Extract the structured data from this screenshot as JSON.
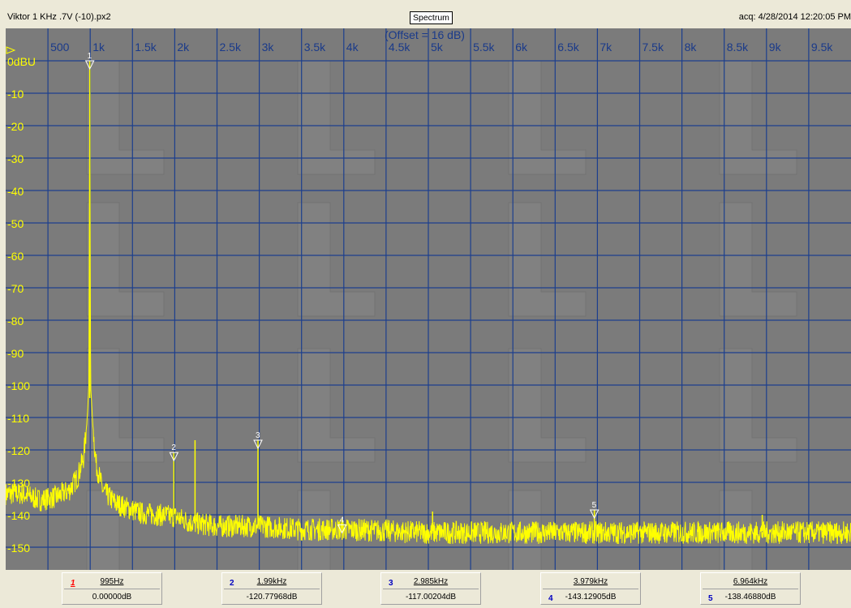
{
  "window": {
    "file_title": "Viktor 1 KHz .7V (-10).px2",
    "view_button": "Spectrum",
    "acq_label": "acq: 4/28/2014 12:20:05 PM"
  },
  "colors": {
    "plot_bg": "#7b7b7b",
    "grid": "#1c3f8e",
    "trace": "#ffff00",
    "y_tick_text": "#ffff00",
    "x_tick_text": "#1a3a8a",
    "marker": "#ffffff",
    "marker_1_number": "#ff0000",
    "marker_number": "#0000c0"
  },
  "chart_data": {
    "type": "line",
    "annotation": "(Offset = 16 dB)",
    "x_unit": "Hz",
    "y_unit": "dBU",
    "xlim": [
      0,
      10000
    ],
    "ylim": [
      -157,
      10
    ],
    "x_ticks": [
      {
        "value": 500,
        "label": "500"
      },
      {
        "value": 1000,
        "label": "1k"
      },
      {
        "value": 1500,
        "label": "1.5k"
      },
      {
        "value": 2000,
        "label": "2k"
      },
      {
        "value": 2500,
        "label": "2.5k"
      },
      {
        "value": 3000,
        "label": "3k"
      },
      {
        "value": 3500,
        "label": "3.5k"
      },
      {
        "value": 4000,
        "label": "4k"
      },
      {
        "value": 4500,
        "label": "4.5k"
      },
      {
        "value": 5000,
        "label": "5k"
      },
      {
        "value": 5500,
        "label": "5.5k"
      },
      {
        "value": 6000,
        "label": "6k"
      },
      {
        "value": 6500,
        "label": "6.5k"
      },
      {
        "value": 7000,
        "label": "7k"
      },
      {
        "value": 7500,
        "label": "7.5k"
      },
      {
        "value": 8000,
        "label": "8k"
      },
      {
        "value": 8500,
        "label": "8.5k"
      },
      {
        "value": 9000,
        "label": "9k"
      },
      {
        "value": 9500,
        "label": "9.5k"
      }
    ],
    "y_ticks": [
      {
        "value": 0,
        "label": "0dBU"
      },
      {
        "value": -10,
        "label": "-10"
      },
      {
        "value": -20,
        "label": "-20"
      },
      {
        "value": -30,
        "label": "-30"
      },
      {
        "value": -40,
        "label": "-40"
      },
      {
        "value": -50,
        "label": "-50"
      },
      {
        "value": -60,
        "label": "-60"
      },
      {
        "value": -70,
        "label": "-70"
      },
      {
        "value": -80,
        "label": "-80"
      },
      {
        "value": -90,
        "label": "-90"
      },
      {
        "value": -100,
        "label": "-100"
      },
      {
        "value": -110,
        "label": "-110"
      },
      {
        "value": -120,
        "label": "-120"
      },
      {
        "value": -130,
        "label": "-130"
      },
      {
        "value": -140,
        "label": "-140"
      },
      {
        "value": -150,
        "label": "-150"
      }
    ],
    "grid": true,
    "series": [
      {
        "values_note_free": true,
        "points": [
          [
            0,
            -133
          ],
          [
            200,
            -133
          ],
          [
            400,
            -135
          ],
          [
            600,
            -134
          ],
          [
            750,
            -132
          ],
          [
            850,
            -128
          ],
          [
            920,
            -122
          ],
          [
            960,
            -112
          ],
          [
            985,
            -100
          ],
          [
            995,
            0
          ],
          [
            1005,
            -100
          ],
          [
            1030,
            -112
          ],
          [
            1070,
            -124
          ],
          [
            1150,
            -132
          ],
          [
            1300,
            -136
          ],
          [
            1600,
            -139
          ],
          [
            1990,
            -140
          ],
          [
            2200,
            -142
          ],
          [
            2500,
            -143
          ],
          [
            3000,
            -143
          ],
          [
            3500,
            -144
          ],
          [
            4000,
            -144
          ],
          [
            5000,
            -145
          ],
          [
            6000,
            -145
          ],
          [
            7000,
            -145
          ],
          [
            8000,
            -145
          ],
          [
            9000,
            -145
          ],
          [
            10000,
            -145
          ]
        ],
        "spurs": [
          [
            1990,
            -120.8
          ],
          [
            2240,
            -117
          ],
          [
            2985,
            -117
          ],
          [
            3979,
            -143
          ],
          [
            5050,
            -139
          ],
          [
            6964,
            -138.5
          ],
          [
            8950,
            -140
          ]
        ]
      }
    ],
    "markers": [
      {
        "id": "1",
        "x": 995,
        "y": 0
      },
      {
        "id": "2",
        "x": 1990,
        "y": -120.8
      },
      {
        "id": "3",
        "x": 2985,
        "y": -117
      },
      {
        "id": "4",
        "x": 3979,
        "y": -143.1
      },
      {
        "id": "5",
        "x": 6964,
        "y": -138.5
      }
    ]
  },
  "marker_readouts": [
    {
      "number": "1",
      "freq": "995Hz",
      "level": "0.00000dB"
    },
    {
      "number": "2",
      "freq": "1.99kHz",
      "level": "-120.77968dB"
    },
    {
      "number": "3",
      "freq": "2.985kHz",
      "level": "-117.00204dB"
    },
    {
      "number": "4",
      "freq": "3.979kHz",
      "level": "-143.12905dB"
    },
    {
      "number": "5",
      "freq": "6.964kHz",
      "level": "-138.46880dB"
    }
  ]
}
